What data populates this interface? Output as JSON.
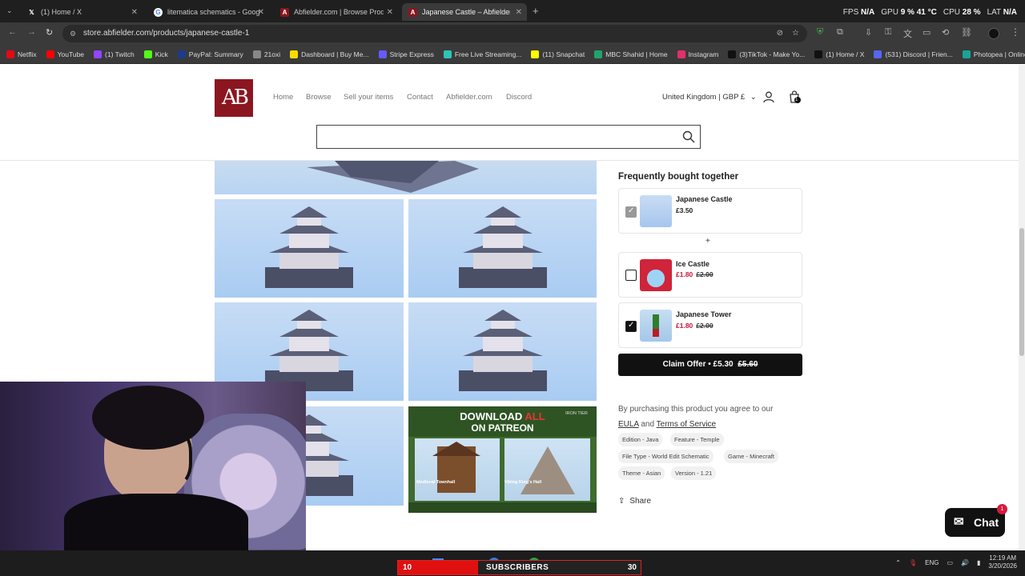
{
  "browser": {
    "tabs": [
      {
        "title": "(1) Home / X",
        "favicon": "x-icon"
      },
      {
        "title": "litematica schematics - Google",
        "favicon": "google-icon"
      },
      {
        "title": "Abfielder.com | Browse Products",
        "favicon": "abfielder-icon"
      },
      {
        "title": "Japanese Castle – Abfielder Pr...",
        "favicon": "abfielder-icon"
      }
    ],
    "url": "store.abfielder.com/products/japanese-castle-1",
    "stats": {
      "fps_label": "FPS",
      "fps": "N/A",
      "gpu_label": "GPU",
      "gpu": "9 %",
      "gpu_temp": "41 °C",
      "cpu_label": "CPU",
      "cpu": "28 %",
      "lat_label": "LAT",
      "lat": "N/A"
    },
    "bookmarks": [
      {
        "label": "Netflix",
        "color": "#e50914"
      },
      {
        "label": "YouTube",
        "color": "#ff0000"
      },
      {
        "label": "(1) Twitch",
        "color": "#9146ff"
      },
      {
        "label": "Kick",
        "color": "#53fc18"
      },
      {
        "label": "PayPal: Summary",
        "color": "#1e3a8a"
      },
      {
        "label": "21oxi",
        "color": "#888888"
      },
      {
        "label": "Dashboard | Buy Me...",
        "color": "#ffdd00"
      },
      {
        "label": "Stripe Express",
        "color": "#635bff"
      },
      {
        "label": "Free Live Streaming...",
        "color": "#2ec4b6"
      },
      {
        "label": "(11) Snapchat",
        "color": "#fffc00"
      },
      {
        "label": "MBC Shahid | Home",
        "color": "#22a36b"
      },
      {
        "label": "Instagram",
        "color": "#e1306c"
      },
      {
        "label": "(3)TikTok - Make Yo...",
        "color": "#111111"
      },
      {
        "label": "(1) Home / X",
        "color": "#111111"
      },
      {
        "label": "(531) Discord | Frien...",
        "color": "#5865f2"
      },
      {
        "label": "Photopea | Online P...",
        "color": "#18a497"
      }
    ]
  },
  "site": {
    "logo_text": "AB",
    "nav": [
      "Home",
      "Browse",
      "Sell your items",
      "Contact",
      "Abfielder.com",
      "Discord"
    ],
    "country": "United Kingdom | GBP £",
    "cart_count": "1",
    "search_placeholder": ""
  },
  "gallery": {
    "banner": {
      "title_a": "DOWNLOAD",
      "title_b": "ALL",
      "title_c": "ON PATREON",
      "tier": "IRON TIER",
      "left_caption": "Medieval Townhall",
      "right_caption": "Viking King's Hall"
    }
  },
  "fbt": {
    "title": "Frequently bought together",
    "plus": "+",
    "items": [
      {
        "name": "Japanese Castle",
        "price": "£3.50",
        "old_price": ""
      },
      {
        "name": "Ice Castle",
        "price": "£1.80",
        "old_price": "£2.00"
      },
      {
        "name": "Japanese Tower",
        "price": "£1.80",
        "old_price": "£2.00"
      }
    ],
    "claim_label": "Claim Offer • £5.30",
    "claim_old": "£5.60"
  },
  "agreement": {
    "text": "By purchasing this product you agree to our",
    "eula": "EULA",
    "and": "and",
    "terms": "Terms of Service"
  },
  "tags": [
    "Edition - Java",
    "Feature - Temple",
    "File Type - World Edit Schematic",
    "Game - Minecraft",
    "Theme - Asian",
    "Version - 1.21"
  ],
  "share_label": "Share",
  "chat": {
    "label": "Chat",
    "badge": "1"
  },
  "taskbar": {
    "subs_current": "10",
    "subs_label": "SUBSCRIBERS",
    "subs_goal": "30",
    "subs_progress": 0.33,
    "lang": "ENG",
    "time": "12:19 AM",
    "date": "3/20/2026"
  }
}
